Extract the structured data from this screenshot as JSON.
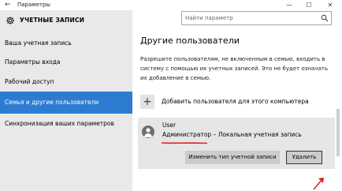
{
  "window": {
    "back_glyph": "←",
    "title": "Параметры",
    "controls": {
      "minimize": "—",
      "maximize": "☐",
      "close": "✕"
    }
  },
  "app": {
    "title": "УЧЕТНЫЕ ЗАПИСИ",
    "icon": "gear-icon"
  },
  "search": {
    "placeholder": "Найти параметр",
    "icon": "search-icon"
  },
  "sidebar": {
    "items": [
      {
        "label": "Ваша учетная запись",
        "active": false
      },
      {
        "label": "Параметры входа",
        "active": false
      },
      {
        "label": "Рабочий доступ",
        "active": false
      },
      {
        "label": "Семья и другие пользователи",
        "active": true
      },
      {
        "label": "Синхронизация ваших параметров",
        "active": false
      }
    ]
  },
  "main": {
    "section_title": "Другие пользователи",
    "info_text": "Разрешите пользователям, не включенным в семью, входить в систему с помощью их учетных записей. Это не будет означать их добавление в семью.",
    "add_user": {
      "plus": "+",
      "label": "Добавить пользователя для этого компьютера"
    },
    "user": {
      "name": "User",
      "role": "Администратор",
      "separator": " – ",
      "account_type": "Локальная учетная запись",
      "change_button": "Изменить тип учетной записи",
      "delete_button": "Удалить"
    }
  },
  "colors": {
    "accent": "#2e7cd1",
    "sidebar_bg": "#e9e9e9",
    "annotation_red": "#e0201c"
  }
}
